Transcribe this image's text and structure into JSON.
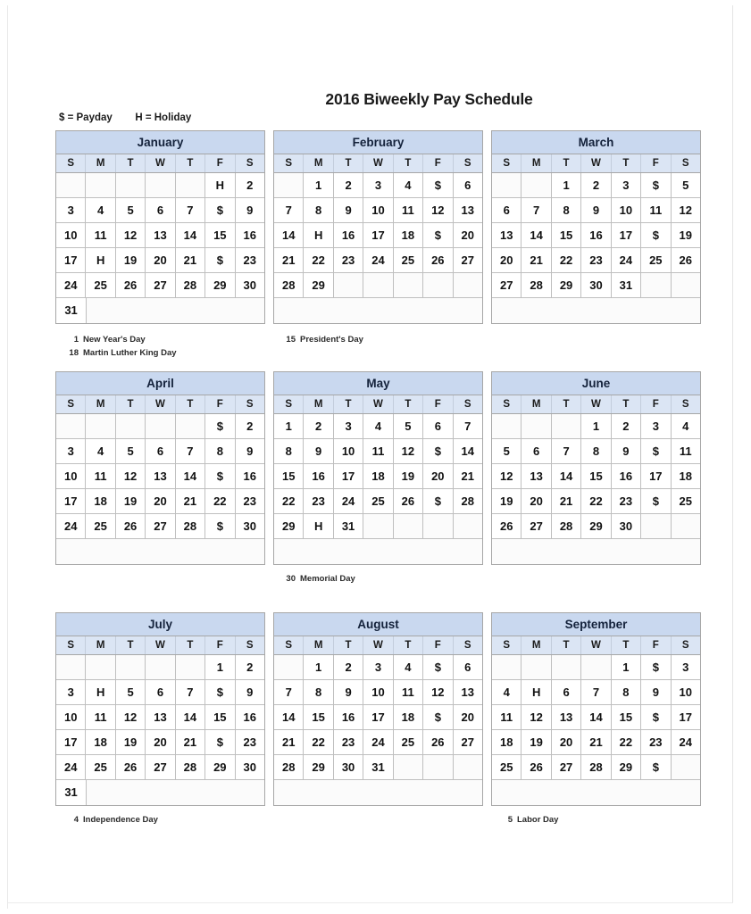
{
  "document": {
    "title": "2016 Biweekly Pay Schedule",
    "legend": "$ = Payday        H = Holiday",
    "payday_symbol": "$",
    "holiday_symbol": "H",
    "colors": {
      "month_header_bg": "#c9d8ef",
      "weekday_header_bg": "#dbe5f4",
      "grid_border": "#a6a6a6",
      "cell_border": "#bfbfbf",
      "text": "#121212",
      "page_bg": "#ffffff"
    }
  },
  "weekday_headers": [
    "S",
    "M",
    "T",
    "W",
    "T",
    "F",
    "S"
  ],
  "months": [
    {
      "name": "January",
      "weeks": [
        [
          "",
          "",
          "",
          "",
          "",
          "H",
          "2"
        ],
        [
          "3",
          "4",
          "5",
          "6",
          "7",
          "$",
          "9"
        ],
        [
          "10",
          "11",
          "12",
          "13",
          "14",
          "15",
          "16"
        ],
        [
          "17",
          "H",
          "19",
          "20",
          "21",
          "$",
          "23"
        ],
        [
          "24",
          "25",
          "26",
          "27",
          "28",
          "29",
          "30"
        ],
        [
          "31",
          "",
          "",
          "",
          "",
          "",
          ""
        ]
      ]
    },
    {
      "name": "February",
      "weeks": [
        [
          "",
          "1",
          "2",
          "3",
          "4",
          "$",
          "6"
        ],
        [
          "7",
          "8",
          "9",
          "10",
          "11",
          "12",
          "13"
        ],
        [
          "14",
          "H",
          "16",
          "17",
          "18",
          "$",
          "20"
        ],
        [
          "21",
          "22",
          "23",
          "24",
          "25",
          "26",
          "27"
        ],
        [
          "28",
          "29",
          "",
          "",
          "",
          "",
          ""
        ],
        [
          "",
          "",
          "",
          "",
          "",
          "",
          ""
        ]
      ]
    },
    {
      "name": "March",
      "weeks": [
        [
          "",
          "",
          "1",
          "2",
          "3",
          "$",
          "5"
        ],
        [
          "6",
          "7",
          "8",
          "9",
          "10",
          "11",
          "12"
        ],
        [
          "13",
          "14",
          "15",
          "16",
          "17",
          "$",
          "19"
        ],
        [
          "20",
          "21",
          "22",
          "23",
          "24",
          "25",
          "26"
        ],
        [
          "27",
          "28",
          "29",
          "30",
          "31",
          "",
          ""
        ],
        [
          "",
          "",
          "",
          "",
          "",
          "",
          ""
        ]
      ]
    },
    {
      "name": "April",
      "weeks": [
        [
          "",
          "",
          "",
          "",
          "",
          "$",
          "2"
        ],
        [
          "3",
          "4",
          "5",
          "6",
          "7",
          "8",
          "9"
        ],
        [
          "10",
          "11",
          "12",
          "13",
          "14",
          "$",
          "16"
        ],
        [
          "17",
          "18",
          "19",
          "20",
          "21",
          "22",
          "23"
        ],
        [
          "24",
          "25",
          "26",
          "27",
          "28",
          "$",
          "30"
        ],
        [
          "",
          "",
          "",
          "",
          "",
          "",
          ""
        ]
      ]
    },
    {
      "name": "May",
      "weeks": [
        [
          "1",
          "2",
          "3",
          "4",
          "5",
          "6",
          "7"
        ],
        [
          "8",
          "9",
          "10",
          "11",
          "12",
          "$",
          "14"
        ],
        [
          "15",
          "16",
          "17",
          "18",
          "19",
          "20",
          "21"
        ],
        [
          "22",
          "23",
          "24",
          "25",
          "26",
          "$",
          "28"
        ],
        [
          "29",
          "H",
          "31",
          "",
          "",
          "",
          ""
        ],
        [
          "",
          "",
          "",
          "",
          "",
          "",
          ""
        ]
      ]
    },
    {
      "name": "June",
      "weeks": [
        [
          "",
          "",
          "",
          "1",
          "2",
          "3",
          "4"
        ],
        [
          "5",
          "6",
          "7",
          "8",
          "9",
          "$",
          "11"
        ],
        [
          "12",
          "13",
          "14",
          "15",
          "16",
          "17",
          "18"
        ],
        [
          "19",
          "20",
          "21",
          "22",
          "23",
          "$",
          "25"
        ],
        [
          "26",
          "27",
          "28",
          "29",
          "30",
          "",
          ""
        ],
        [
          "",
          "",
          "",
          "",
          "",
          "",
          ""
        ]
      ]
    },
    {
      "name": "July",
      "weeks": [
        [
          "",
          "",
          "",
          "",
          "",
          "1",
          "2"
        ],
        [
          "3",
          "H",
          "5",
          "6",
          "7",
          "$",
          "9"
        ],
        [
          "10",
          "11",
          "12",
          "13",
          "14",
          "15",
          "16"
        ],
        [
          "17",
          "18",
          "19",
          "20",
          "21",
          "$",
          "23"
        ],
        [
          "24",
          "25",
          "26",
          "27",
          "28",
          "29",
          "30"
        ],
        [
          "31",
          "",
          "",
          "",
          "",
          "",
          ""
        ]
      ]
    },
    {
      "name": "August",
      "weeks": [
        [
          "",
          "1",
          "2",
          "3",
          "4",
          "$",
          "6"
        ],
        [
          "7",
          "8",
          "9",
          "10",
          "11",
          "12",
          "13"
        ],
        [
          "14",
          "15",
          "16",
          "17",
          "18",
          "$",
          "20"
        ],
        [
          "21",
          "22",
          "23",
          "24",
          "25",
          "26",
          "27"
        ],
        [
          "28",
          "29",
          "30",
          "31",
          "",
          "",
          ""
        ],
        [
          "",
          "",
          "",
          "",
          "",
          "",
          ""
        ]
      ]
    },
    {
      "name": "September",
      "weeks": [
        [
          "",
          "",
          "",
          "",
          "1",
          "$",
          "3"
        ],
        [
          "4",
          "H",
          "6",
          "7",
          "8",
          "9",
          "10"
        ],
        [
          "11",
          "12",
          "13",
          "14",
          "15",
          "$",
          "17"
        ],
        [
          "18",
          "19",
          "20",
          "21",
          "22",
          "23",
          "24"
        ],
        [
          "25",
          "26",
          "27",
          "28",
          "29",
          "$",
          ""
        ],
        [
          "",
          "",
          "",
          "",
          "",
          "",
          ""
        ]
      ]
    }
  ],
  "notes": {
    "january": [
      {
        "day": "1",
        "label": "New Year's Day"
      },
      {
        "day": "18",
        "label": "Martin Luther King Day"
      }
    ],
    "february": [
      {
        "day": "15",
        "label": "President's Day"
      }
    ],
    "may": [
      {
        "day": "30",
        "label": "Memorial Day"
      }
    ],
    "july": [
      {
        "day": "4",
        "label": "Independence Day"
      }
    ],
    "september": [
      {
        "day": "5",
        "label": "Labor Day"
      }
    ]
  }
}
